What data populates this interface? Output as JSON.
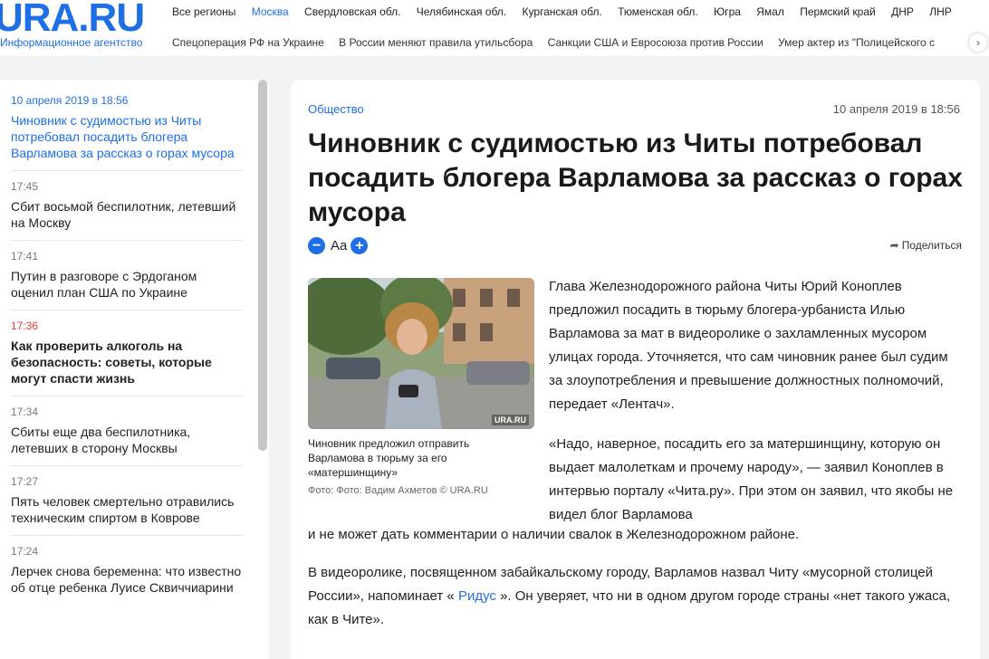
{
  "header": {
    "logo": "URA.RU",
    "logo_subtitle": "Информационное агентство",
    "regions": [
      "Все регионы",
      "Москва",
      "Свердловская обл.",
      "Челябинская обл.",
      "Курганская обл.",
      "Тюменская обл.",
      "Югра",
      "Ямал",
      "Пермский край",
      "ДНР",
      "ЛНР"
    ],
    "active_region": "Москва",
    "topics": [
      "Спецоперация РФ на Украине",
      "В России меняют правила утильсбора",
      "Санкции США и Евросоюза против России",
      "Умер актер из \"Полицейского с"
    ],
    "topics_arrow": "›"
  },
  "sidebar": {
    "items": [
      {
        "time": "10 апреля 2019 в 18:56",
        "title": "Чиновник с судимостью из Читы потребовал посадить блогера Варламова за рассказ о горах мусора"
      },
      {
        "time": "17:45",
        "title": "Сбит восьмой беспилотник, летевший на Москву"
      },
      {
        "time": "17:41",
        "title": "Путин в разговоре с Эрдоганом оценил план США по Украине"
      },
      {
        "time": "17:36",
        "title": "Как проверить алкоголь на безопасность: советы, которые могут спасти жизнь"
      },
      {
        "time": "17:34",
        "title": "Сбиты еще два беспилотника, летевших в сторону Москвы"
      },
      {
        "time": "17:27",
        "title": "Пять человек смертельно отравились техническим спиртом в Коврове"
      },
      {
        "time": "17:24",
        "title": "Лерчек снова беременна: что известно об отце ребенка Луисе Сквиччиарини"
      }
    ]
  },
  "article": {
    "rubric": "Общество",
    "date": "10 апреля 2019 в 18:56",
    "title": "Чиновник с судимостью из Читы потребовал посадить блогера Варламова за рассказ о горах мусора",
    "font_decrease": "−",
    "font_label": "Aa",
    "font_increase": "+",
    "share_label": "Поделиться",
    "photo_watermark": "URA.RU",
    "photo_caption": "Чиновник предложил отправить Варламова в тюрьму за его «матершинщину»",
    "photo_credit": "Фото: Фото: Вадим Ахметов © URA.RU",
    "paragraph1": "Глава Железнодорожного района Читы Юрий Коноплев предложил посадить в тюрьму блогера-урбаниста Илью Варламова за мат в видеоролике о захламленных мусором улицах города. Уточняется, что сам чиновник ранее был судим за злоупотребления и превышение должностных полномочий, передает «Лентач».",
    "paragraph2_part1": "«Надо, наверное, посадить его за матершинщину, которую он выдает малолеткам и прочему народу», — заявил Коноплев в интервью порталу «Чита.ру». При этом он заявил, что якобы не видел блог Варламова",
    "paragraph2_part2": "и не может дать комментарии о наличии свалок в Железнодорожном районе.",
    "paragraph3_before": "В видеоролике, посвященном забайкальскому городу, Варламов назвал Читу «мусорной столицей России», напоминает «",
    "paragraph3_link": "Ридус",
    "paragraph3_after": "». Он уверяет, что ни в одном другом городе страны «нет такого ужаса, как в Чите»."
  }
}
